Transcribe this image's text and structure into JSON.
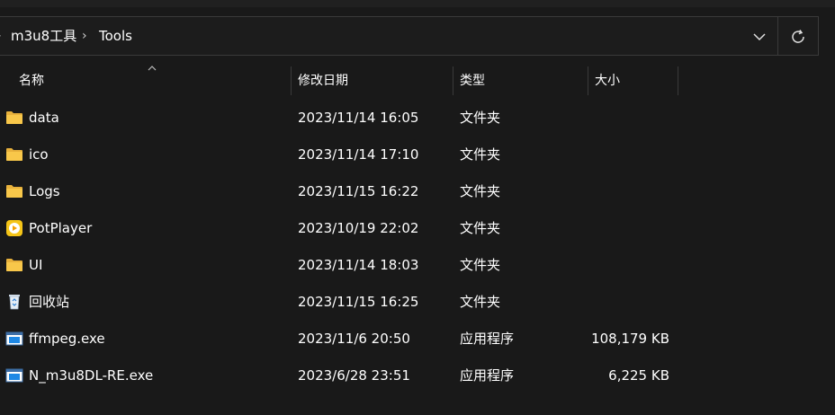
{
  "breadcrumb": {
    "items": [
      "m3u8工具",
      "Tools"
    ],
    "separator": "›"
  },
  "columns": {
    "name": "名称",
    "modified": "修改日期",
    "type": "类型",
    "size": "大小"
  },
  "files": [
    {
      "name": "data",
      "modified": "2023/11/14 16:05",
      "type": "文件夹",
      "size": "",
      "icon": "folder-icon"
    },
    {
      "name": "ico",
      "modified": "2023/11/14 17:10",
      "type": "文件夹",
      "size": "",
      "icon": "folder-icon"
    },
    {
      "name": "Logs",
      "modified": "2023/11/15 16:22",
      "type": "文件夹",
      "size": "",
      "icon": "folder-icon"
    },
    {
      "name": "PotPlayer",
      "modified": "2023/10/19 22:02",
      "type": "文件夹",
      "size": "",
      "icon": "potplayer-icon"
    },
    {
      "name": "UI",
      "modified": "2023/11/14 18:03",
      "type": "文件夹",
      "size": "",
      "icon": "folder-icon"
    },
    {
      "name": "回收站",
      "modified": "2023/11/15 16:25",
      "type": "文件夹",
      "size": "",
      "icon": "recycle-bin-icon"
    },
    {
      "name": "ffmpeg.exe",
      "modified": "2023/11/6 20:50",
      "type": "应用程序",
      "size": "108,179 KB",
      "icon": "exe-icon"
    },
    {
      "name": "N_m3u8DL-RE.exe",
      "modified": "2023/6/28 23:51",
      "type": "应用程序",
      "size": "6,225 KB",
      "icon": "exe-icon"
    }
  ],
  "colors": {
    "background": "#191919",
    "folder": "#f8c74a",
    "potplayer": "#f5c518"
  }
}
